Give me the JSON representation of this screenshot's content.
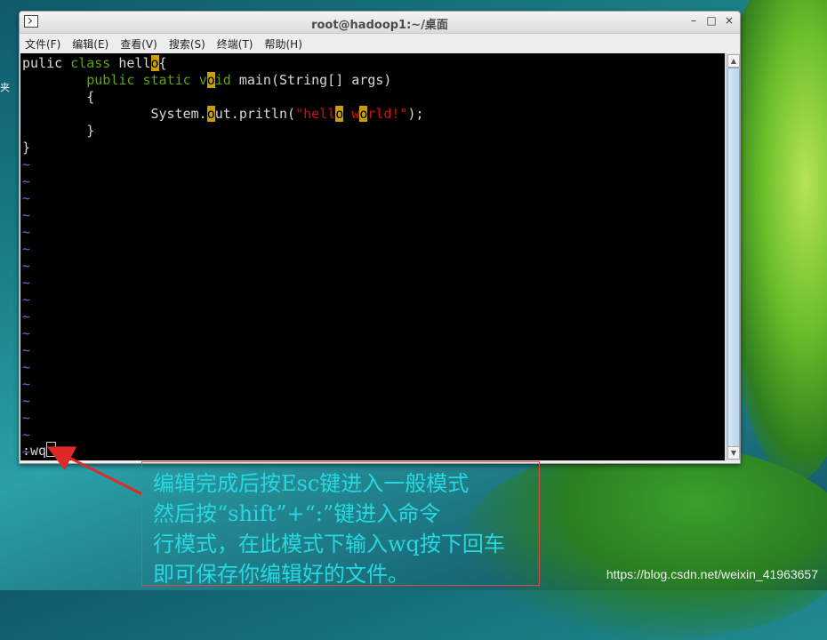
{
  "desktop": {
    "fragment_text": "夹",
    "watermark": "https://blog.csdn.net/weixin_41963657"
  },
  "window": {
    "title": "root@hadoop1:~/桌面",
    "controls": {
      "minimize": "–",
      "maximize": "□",
      "close": "×"
    }
  },
  "menubar": [
    "文件(F)",
    "编辑(E)",
    "查看(V)",
    "搜索(S)",
    "终端(T)",
    "帮助(H)"
  ],
  "editor": {
    "line1": {
      "a": "pulic ",
      "b": "class",
      "c": " hell",
      "d": "o",
      "e": "{"
    },
    "line2": {
      "indent": "        ",
      "a": "public",
      "b": " ",
      "c": "static",
      "d": " ",
      "e": "v",
      "f": "o",
      "g": "id",
      "h": " main(String[] args)"
    },
    "line3": "        {",
    "line4": {
      "indent": "                System.",
      "a": "o",
      "b": "ut.pritln(",
      "c": "\"hell",
      "d": "o",
      "e": " ",
      "f": "w",
      "g": "o",
      "h": "rld!\"",
      "i": ");"
    },
    "line5": "        }",
    "line6": "}",
    "tilde": "~",
    "tilde_count": 18,
    "command": ":wq"
  },
  "annotation": {
    "lines": [
      "编辑完成后按Esc键进入一般模式",
      "然后按“shift”+“:”键进入命令",
      "行模式，在此模式下输入wq按下回车",
      "即可保存你编辑好的文件。"
    ],
    "text_color": "#28d8e0",
    "border_color": "#e04848"
  }
}
